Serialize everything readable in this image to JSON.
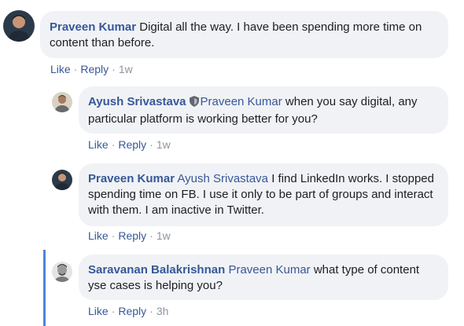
{
  "comments": [
    {
      "author": "Praveen Kumar",
      "mention": "",
      "text": "Digital all the way. I have been spending more time on content than before.",
      "like": "Like",
      "reply": "Reply",
      "time": "1w"
    },
    {
      "author": "Ayush Srivastava",
      "badge_icon": "shield-icon",
      "mention": "Praveen Kumar",
      "text": "when you say digital, any particular platform is working better for you?",
      "like": "Like",
      "reply": "Reply",
      "time": "1w"
    },
    {
      "author": "Praveen Kumar",
      "mention": "Ayush Srivastava",
      "text": "I find LinkedIn works. I stopped spending time on FB. I use it only to be part of groups and interact with them. I am inactive in Twitter.",
      "like": "Like",
      "reply": "Reply",
      "time": "1w"
    },
    {
      "author": "Saravanan Balakrishnan",
      "mention": "Praveen Kumar",
      "text": "what type of content yse cases is helping you?",
      "like": "Like",
      "reply": "Reply",
      "time": "3h"
    }
  ],
  "separator": "·",
  "colors": {
    "author": "#365899",
    "bubble": "#f0f2f5",
    "thread_line": "#4d85d9"
  }
}
